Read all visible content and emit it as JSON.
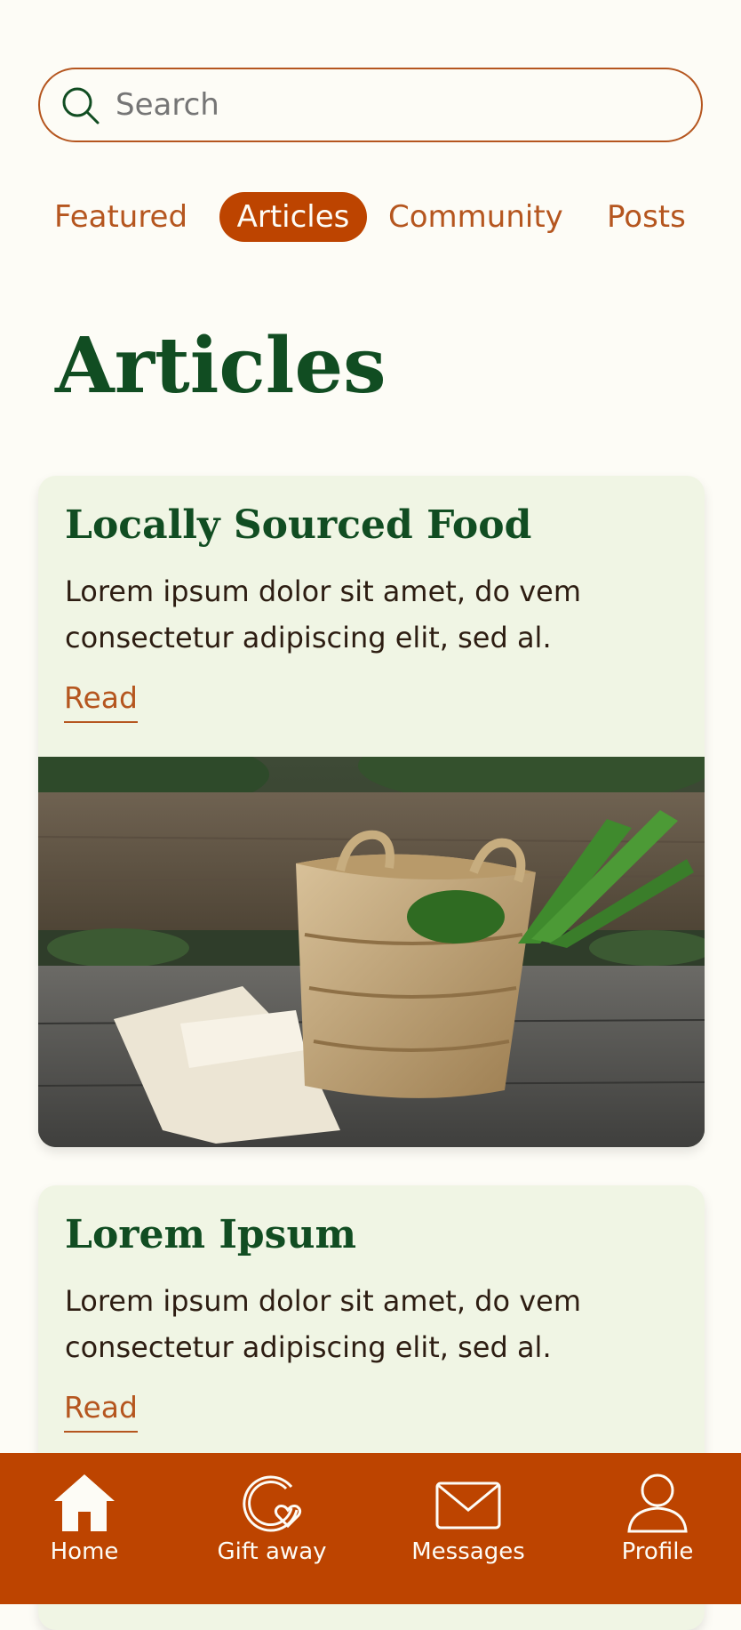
{
  "search": {
    "placeholder": "Search"
  },
  "tabs": [
    {
      "label": "Featured",
      "active": false
    },
    {
      "label": "Articles",
      "active": true
    },
    {
      "label": "Community",
      "active": false
    },
    {
      "label": "Posts",
      "active": false
    }
  ],
  "page": {
    "title": "Articles"
  },
  "articles": [
    {
      "title": "Locally Sourced Food",
      "body": "Lorem ipsum dolor sit amet, do vem consectetur adipiscing elit, sed al.",
      "read_label": "Read",
      "image": "woven-basket-with-greens-on-bench-photo"
    },
    {
      "title": "Lorem Ipsum",
      "body": "Lorem ipsum dolor sit amet, do vem consectetur adipiscing elit, sed al.",
      "read_label": "Read"
    }
  ],
  "nav": {
    "items": [
      {
        "label": "Home",
        "icon": "home-icon"
      },
      {
        "label": "Gift away",
        "icon": "gift-away-icon"
      },
      {
        "label": "Messages",
        "icon": "envelope-icon"
      },
      {
        "label": "Profile",
        "icon": "user-icon"
      }
    ]
  },
  "colors": {
    "background": "#fdfcf6",
    "accent": "#bd4400",
    "title_green": "#114d22",
    "card_bg": "#f0f5e4",
    "text": "#2d1d12"
  }
}
